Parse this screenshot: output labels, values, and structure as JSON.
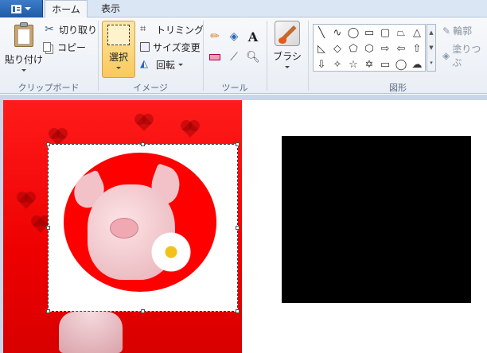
{
  "tabs": {
    "home": "ホーム",
    "view": "表示"
  },
  "clipboard": {
    "paste": "貼り付け",
    "cut": "切り取り",
    "copy": "コピー",
    "group": "クリップボード"
  },
  "image": {
    "select": "選択",
    "crop": "トリミング",
    "resize": "サイズ変更",
    "rotate": "回転",
    "group": "イメージ"
  },
  "tools": {
    "group": "ツール",
    "text_glyph": "A"
  },
  "brush": {
    "label": "ブラシ"
  },
  "shapes": {
    "group": "図形",
    "outline": "輪郭",
    "fill": "塗りつぶ"
  },
  "colors": {
    "accent": "#2a66b4",
    "image_bg": "#ee0000",
    "canvas": "#ffffff",
    "black_shape": "#000000"
  }
}
